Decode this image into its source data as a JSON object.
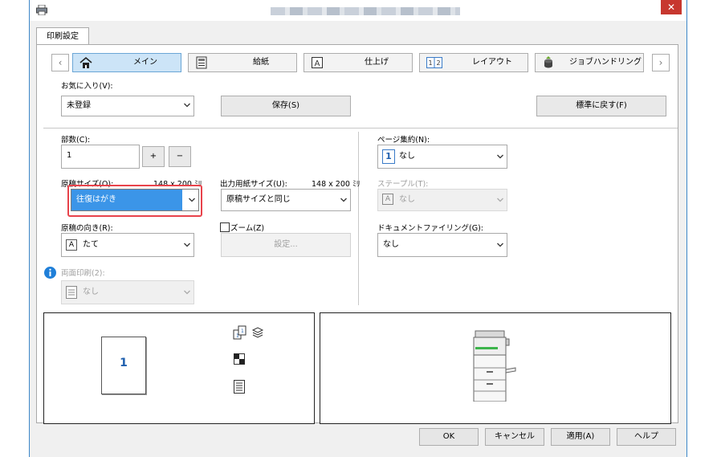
{
  "window": {
    "tab_label": "印刷設定",
    "close_glyph": "✕"
  },
  "nav": {
    "prev_glyph": "‹",
    "next_glyph": "›",
    "tabs": [
      {
        "label": "メイン",
        "icon": "home-icon"
      },
      {
        "label": "給紙",
        "icon": "paper-tray-icon"
      },
      {
        "label": "仕上げ",
        "icon": "finishing-icon"
      },
      {
        "label": "レイアウト",
        "icon": "layout-icon"
      },
      {
        "label": "ジョブハンドリング",
        "icon": "job-handling-icon"
      }
    ]
  },
  "favorites": {
    "label": "お気に入り(V):",
    "value": "未登録",
    "save_label": "保存(S)",
    "reset_label": "標準に戻す(F)"
  },
  "copies": {
    "label": "部数(C):",
    "value": "1",
    "plus": "+",
    "minus": "−"
  },
  "original_size": {
    "label": "原稿サイズ(O):",
    "dims": "148 x 200 ﾐﾘ",
    "value": "往復はがき"
  },
  "output_size": {
    "label": "出力用紙サイズ(U):",
    "dims": "148 x 200 ﾐﾘ",
    "value": "原稿サイズと同じ"
  },
  "orientation": {
    "label": "原稿の向き(R):",
    "icon_text": "A",
    "value": "たて"
  },
  "zoom": {
    "label": "ズーム(Z)",
    "settings_label": "設定..."
  },
  "duplex": {
    "label": "両面印刷(2):",
    "value": "なし"
  },
  "pages_per_sheet": {
    "label": "ページ集約(N):",
    "icon_text": "1",
    "value": "なし"
  },
  "staple": {
    "label": "ステープル(T):",
    "icon_text": "A",
    "value": "なし"
  },
  "doc_filing": {
    "label": "ドキュメントファイリング(G):",
    "value": "なし"
  },
  "preview": {
    "page_number": "1"
  },
  "footer": {
    "ok": "OK",
    "cancel": "キャンセル",
    "apply": "適用(A)",
    "help": "ヘルプ"
  },
  "colors": {
    "accent": "#3b95e8",
    "highlight_border": "#e8434b",
    "active_tab": "#cce4f7"
  }
}
